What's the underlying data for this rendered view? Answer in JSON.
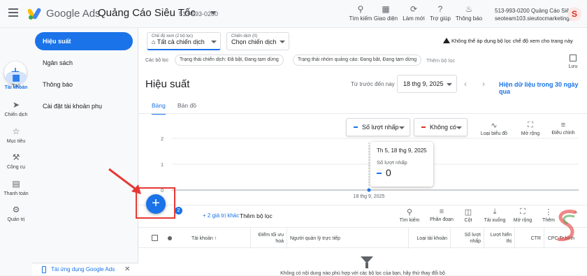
{
  "header": {
    "brand": "Google Ads",
    "account_title": "Quảng Cáo Siêu Tốc",
    "account_id": "513-993-0200",
    "tools": [
      {
        "label": "Tìm kiếm",
        "icon": "search-icon"
      },
      {
        "label": "Giao diện",
        "icon": "appearance-icon"
      },
      {
        "label": "Làm mới",
        "icon": "refresh-icon"
      },
      {
        "label": "Trợ giúp",
        "icon": "help-icon"
      },
      {
        "label": "Thông báo",
        "icon": "bell-icon"
      }
    ],
    "account_line1": "513-993-0200 Quảng Cáo Siêu...",
    "account_line2": "seoteam103.sieutocmarketing...",
    "avatar_letter": "S"
  },
  "rail": {
    "create_label": "Tạo",
    "items": [
      {
        "label": "Tài khoản",
        "icon": "account-icon"
      },
      {
        "label": "Chiến dịch",
        "icon": "campaign-icon"
      },
      {
        "label": "Mục tiêu",
        "icon": "trophy-icon"
      },
      {
        "label": "Công cụ",
        "icon": "tools-icon"
      },
      {
        "label": "Thanh toán",
        "icon": "billing-icon"
      },
      {
        "label": "Quản trị",
        "icon": "gear-icon"
      }
    ]
  },
  "nav": {
    "items": [
      {
        "label": "Hiệu suất"
      },
      {
        "label": "Ngân sách"
      },
      {
        "label": "Thông báo"
      },
      {
        "label": "Cài đặt tài khoản phụ"
      }
    ],
    "app_download": "Tải ứng dụng Google Ads"
  },
  "main": {
    "view_mode_label": "Chế độ xem (2 bộ lọc)",
    "view_mode_value": "Tất cả chiến dịch",
    "campaign_label": "Chiến dịch (0)",
    "campaign_value": "Chọn chiến dịch",
    "warning": "Không thể áp dụng bộ lọc chế độ xem cho trang này",
    "filters_label": "Các bộ lọc",
    "chips": [
      "Trạng thái chiến dịch: Đã bật, Đang tạm dừng",
      "Trạng thái nhóm quảng cáo: Đang bật, Đang tạm dừng"
    ],
    "add_filter": "Thêm bộ lọc",
    "save_label": "Lưu",
    "title": "Hiệu suất",
    "range_label": "Từ trước đến nay",
    "date_value": "18 thg 9, 2025",
    "show_30": "Hiện dữ liệu trong 30 ngày qua",
    "tabs": [
      "Bảng",
      "Bản đồ"
    ],
    "metric1": "Số lượt nhấp",
    "metric2": "Không có",
    "chart_tools": [
      "Loại biểu đồ",
      "Mở rộng",
      "Điều chỉnh"
    ],
    "tooltip": {
      "date": "Th 5, 18 thg 9, 2025",
      "metric": "Số lượt nhấp",
      "value": "0"
    },
    "table_badge": "2",
    "more_filters": "+ 2 giá trị khác",
    "add_filter2": "Thêm bộ lọc",
    "table_tools": [
      "Tìm kiếm",
      "Phân đoạn",
      "Cột",
      "Tải xuống",
      "Mở rộng",
      "Thêm"
    ],
    "columns": [
      "Tài khoản",
      "Điểm tối ưu hoá",
      "Người quản lý trực tiếp",
      "Loại tài khoản",
      "Số lượt nhấp",
      "Lượt hiển thị",
      "CTR",
      "CPC Tr.bình"
    ],
    "empty_text": "Không có nội dung nào phù hợp với các bộ lọc của bạn, hãy thử thay đổi bộ"
  },
  "chart_data": {
    "type": "line",
    "x": [
      "18 thg 9, 2025"
    ],
    "series": [
      {
        "name": "Số lượt nhấp",
        "values": [
          0
        ]
      }
    ],
    "ylim": [
      0,
      2
    ],
    "yticks": [
      "0",
      "1",
      "2"
    ]
  },
  "colors": {
    "accent": "#1a73e8",
    "highlight": "#e53935"
  }
}
